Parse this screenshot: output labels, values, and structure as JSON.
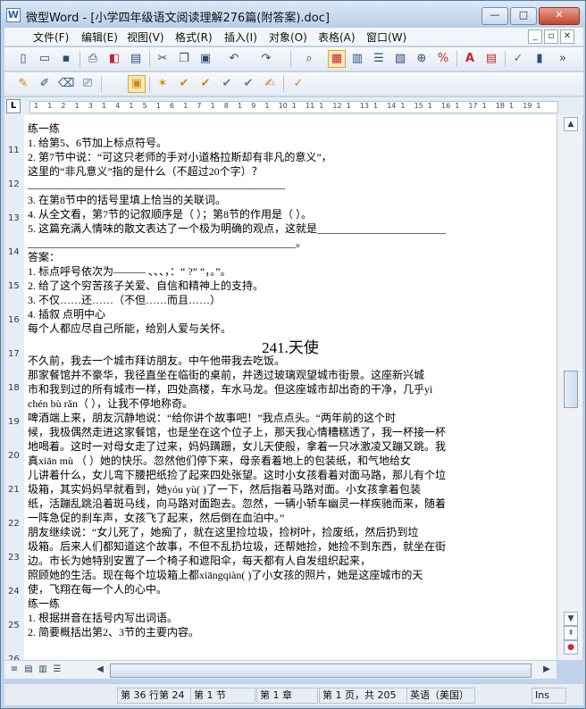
{
  "window": {
    "title": "微型Word - [小学四年级语文阅读理解276篇(附答案).doc]",
    "buttons": {
      "minimize": "—",
      "maximize": "□",
      "close": "✕"
    }
  },
  "menu": {
    "items": [
      "文件(F)",
      "编辑(E)",
      "视图(V)",
      "格式(R)",
      "插入(I)",
      "对象(O)",
      "表格(A)",
      "窗口(W)"
    ],
    "mdi": [
      "_",
      "▫",
      "✕"
    ]
  },
  "toolbar1": {
    "buttons": [
      {
        "name": "new-icon",
        "glyph": "▯"
      },
      {
        "name": "open-icon",
        "glyph": "▭"
      },
      {
        "name": "save-icon",
        "glyph": "▪"
      },
      {
        "name": "print-icon",
        "glyph": "⎙"
      },
      {
        "name": "pdf-icon",
        "glyph": "◧"
      },
      {
        "name": "preview-icon",
        "glyph": "▤"
      },
      {
        "name": "cut-icon",
        "glyph": "✂"
      },
      {
        "name": "copy-icon",
        "glyph": "❐"
      },
      {
        "name": "paste-icon",
        "glyph": "▣"
      },
      {
        "name": "undo-icon",
        "glyph": "↶"
      },
      {
        "name": "redo-icon",
        "glyph": "↷"
      },
      {
        "name": "find-icon",
        "glyph": "⌕"
      },
      {
        "name": "page-view-icon",
        "glyph": "▦"
      },
      {
        "name": "layout-view-icon",
        "glyph": "▥"
      },
      {
        "name": "outline-view-icon",
        "glyph": "☰"
      },
      {
        "name": "web-view-icon",
        "glyph": "▧"
      },
      {
        "name": "zoom-icon",
        "glyph": "⊕"
      },
      {
        "name": "zoom-percent-icon",
        "glyph": "%"
      },
      {
        "name": "font-icon",
        "glyph": "A"
      },
      {
        "name": "format-icon",
        "glyph": "▤"
      },
      {
        "name": "spellcheck-icon",
        "glyph": "✓"
      },
      {
        "name": "stats-icon",
        "glyph": "▮"
      },
      {
        "name": "more-icon",
        "glyph": "»"
      }
    ]
  },
  "toolbar2": {
    "buttons": [
      {
        "name": "edit-icon",
        "glyph": "✎"
      },
      {
        "name": "edit2-icon",
        "glyph": "✐"
      },
      {
        "name": "edit3-icon",
        "glyph": "⌫"
      },
      {
        "name": "edit4-icon",
        "glyph": "⎚"
      },
      {
        "name": "folder-icon",
        "glyph": "▣"
      },
      {
        "name": "star-icon",
        "glyph": "✶"
      },
      {
        "name": "mark1-icon",
        "glyph": "✔"
      },
      {
        "name": "mark2-icon",
        "glyph": "✔"
      },
      {
        "name": "mark3-icon",
        "glyph": "✔"
      },
      {
        "name": "mark4-icon",
        "glyph": "✔"
      },
      {
        "name": "note-icon",
        "glyph": "✍"
      },
      {
        "name": "review-icon",
        "glyph": "✓"
      }
    ]
  },
  "ruler": {
    "box": "L",
    "numbers": [
      "1",
      "1",
      "2",
      "1",
      "3",
      "1",
      "4",
      "1",
      "5",
      "1",
      "6",
      "1",
      "7",
      "1",
      "8",
      "1",
      "9",
      "1",
      "10",
      "1",
      "11",
      "1",
      "12",
      "1",
      "13",
      "1",
      "14",
      "1",
      "15",
      "1",
      "16",
      "1",
      "17",
      "1",
      "18",
      "1",
      "19",
      "1",
      "20",
      "1",
      "21",
      "1",
      "22",
      "1",
      "23",
      "1",
      "24",
      "1",
      "25",
      "1",
      "26",
      "1",
      "27",
      "1",
      "28",
      "1",
      "29",
      "1",
      "30",
      "1",
      "31",
      "1",
      "32",
      "1",
      "33",
      "1",
      "34",
      "1",
      "35",
      "1",
      "36",
      "1",
      "37",
      "1",
      "38",
      "1"
    ]
  },
  "vruler": {
    "numbers": [
      "11",
      "12",
      "13",
      "14",
      "15",
      "16",
      "17",
      "18",
      "19",
      "20",
      "21",
      "22",
      "23",
      "24",
      "25",
      "26"
    ]
  },
  "document": {
    "title": "241.天使",
    "lines": [
      "练一练",
      "1.   给第5、6节加上标点符号。",
      "2.   第7节中说：“可这只老师的手对小道格拉斯却有非凡的意义”，",
      "      这里的“非凡意义”指的是什么（不超过20个字）？",
      "      ________________________________________________",
      "3.   在第8节中的括号里填上恰当的关联词。",
      "4.   从全文看，第7节的记叙顺序是（        ）；第8节的作用是（        ）。",
      "5.   这篇充满人情味的散文表达了一个极为明确的观点，这就是________________________",
      "      __________________________________________________。",
      "答案：",
      "      1.   标点呼号依次为———  、、、，：“  ?”  “，。”。",
      "      2.   给了这个穷苦孩子关爱、自信和精神上的支持。",
      "      3.   不仅……还……（不但……而且……）",
      "      4.   插叙  点明中心",
      "每个人都应尽自己所能，给别人爱与关怀。",
      "        不久前，我去一个城市拜访朋友。中午他带我去吃饭。",
      "        那家餐馆并不豪华，我径直坐在临街的桌前，并透过玻璃观望城市街景。这座新兴城",
      "市和我到过的所有城市一样，四处高楼，车水马龙。但这座城市却出奇的干净，几乎yì",
      "chén      bù  rǎn（        ），让我不停地称奇。",
      "        啤酒端上来，朋友沉静地说：“给你讲个故事吧！”我点点头。“两年前的这个时",
      "候，我极偶然走进这家餐馆，也是坐在这个位子上，那天我心情糟糕透了，我一杯接一杯",
      "地喝着。这时一对母女走了过来，妈妈蹒跚，女儿天使般，拿着一只冰激凌又蹦又跳。我",
      "真xiān      mù  （        ）她的快乐。忽然他们停下来，母亲看着地上的包装纸，和气地给女",
      "儿讲着什么，女儿弯下腰把纸捡了起来四处张望。这时小女孩看着对面马路，那儿有个垃",
      "圾箱，其实妈妈早就看到，她yóu      yù(        )了一下，然后指着马路对面。小女孩拿着包装",
      "纸，活蹦乱跳沿着斑马线，向马路对面跑去。忽然，一辆小轿车幽灵一样疾驰而来，随着",
      "一阵急促的刹车声，女孩飞了起来，然后倒在血泊中。”",
      "        朋友继续说：“女儿死了，她痴了，就在这里捡垃圾，捡树叶，捡废纸，然后扔到垃",
      "圾箱。后来人们都知道这个故事，不但不乱扔垃圾，还帮她捡，她捡不到东西，就坐在街",
      "边。市长为她特别安置了一个椅子和遮阳伞，每天都有人自发组织起来，",
      "照顾她的生活。现在每个垃圾箱上都xiāngqiàn(        )了小女孩的照片，她是这座城市的天",
      "使，飞翔在每一个人的心中。",
      "        练一练",
      "        1.   根据拼音在括号内写出词语。",
      "        2.   简要概括出第2、3节的主要内容。"
    ]
  },
  "status": {
    "fields": [
      "第 36 行第 24",
      "第 1 节",
      "第 1 章",
      "第 1 页，共 205",
      "英语（美国）",
      "Ins"
    ]
  }
}
